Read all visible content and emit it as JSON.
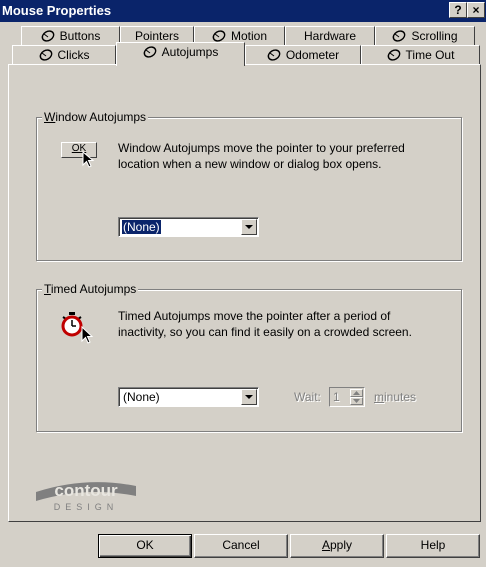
{
  "window": {
    "title": "Mouse Properties",
    "help_glyph": "?",
    "close_glyph": "×"
  },
  "tabs_row1": [
    {
      "label": "Buttons",
      "icon": "mouse-icon"
    },
    {
      "label": "Pointers",
      "icon": ""
    },
    {
      "label": "Motion",
      "icon": "mouse-icon"
    },
    {
      "label": "Hardware",
      "icon": ""
    },
    {
      "label": "Scrolling",
      "icon": "mouse-icon"
    }
  ],
  "tabs_row2": [
    {
      "label": "Clicks",
      "icon": "mouse-icon"
    },
    {
      "label": "Autojumps",
      "icon": "mouse-icon",
      "active": true
    },
    {
      "label": "Odometer",
      "icon": "mouse-icon"
    },
    {
      "label": "Time Out",
      "icon": "mouse-icon"
    }
  ],
  "window_autojumps": {
    "group_label_first": "W",
    "group_label_rest": "indow Autojumps",
    "icon_button_label": "OK",
    "description": "Window Autojumps move the pointer to your preferred location when a new window or dialog box opens.",
    "select_value": "(None)"
  },
  "timed_autojumps": {
    "group_label_first": "T",
    "group_label_rest": "imed Autojumps",
    "description": "Timed Autojumps move the pointer after a period of inactivity, so you can find it easily on a crowded screen.",
    "select_value": "(None)",
    "wait_label": "Wait:",
    "wait_value": "1",
    "minutes_first": "m",
    "minutes_rest": "inutes"
  },
  "logo": {
    "brand": "contour",
    "sub": "DESIGN"
  },
  "footer": {
    "ok": "OK",
    "cancel": "Cancel",
    "apply_first": "A",
    "apply_rest": "pply",
    "help": "Help"
  },
  "colors": {
    "titlebar": "#0a246a",
    "face": "#d4d0c8",
    "highlight": "#0a246a"
  }
}
